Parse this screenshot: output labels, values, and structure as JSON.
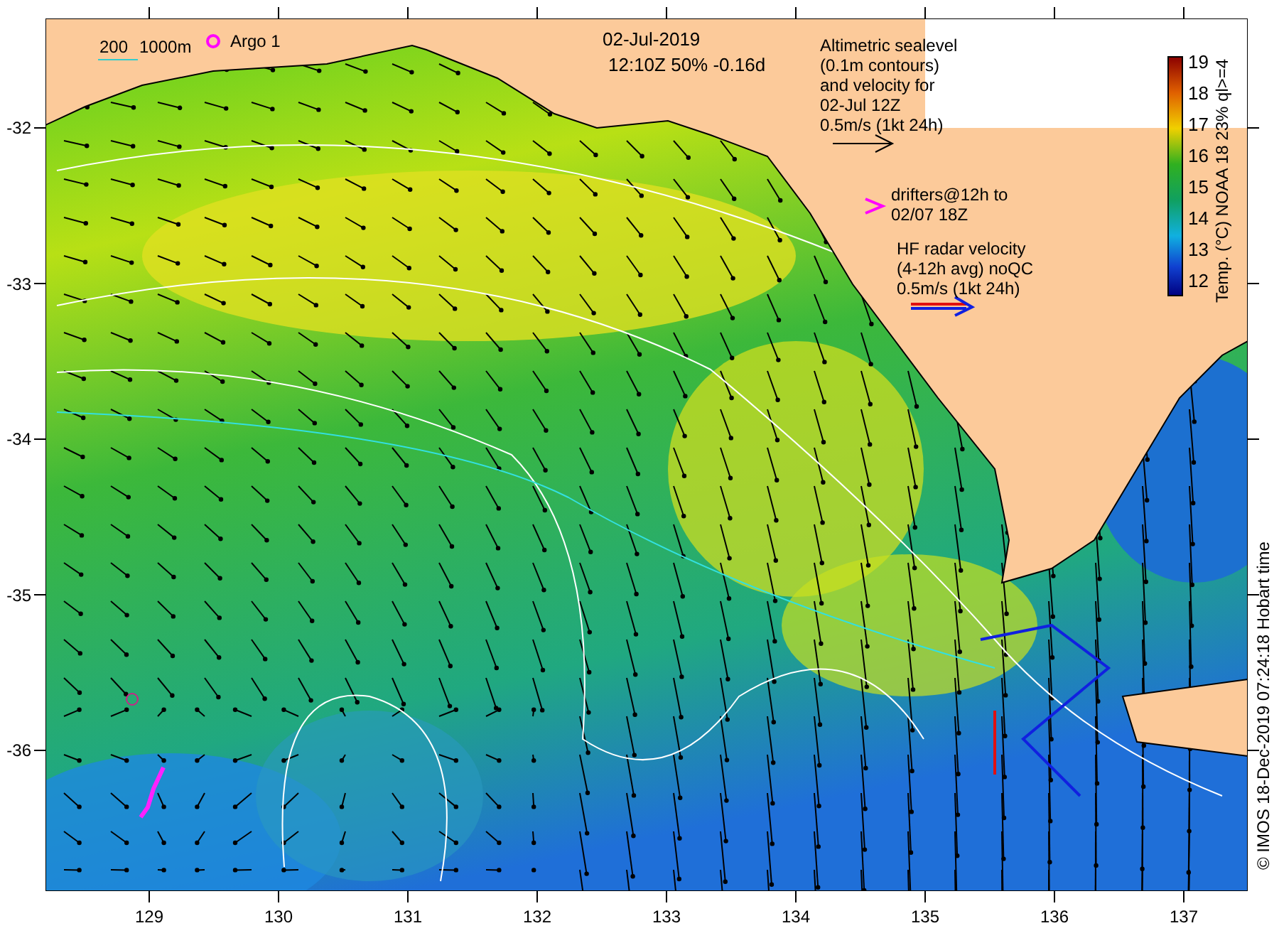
{
  "map": {
    "date": "02-Jul-2019",
    "time_line": "12:10Z  50% -0.16d",
    "depth_legend": {
      "shallow": "200",
      "deep": "1000m"
    },
    "argo_legend": "Argo 1",
    "altimetry_legend": [
      "Altimetric sealevel",
      "(0.1m contours)",
      "and velocity for",
      "02-Jul 12Z",
      "0.5m/s (1kt 24h)"
    ],
    "drifter_legend": [
      "drifters@12h to",
      "02/07 18Z"
    ],
    "radar_legend": [
      "HF radar velocity",
      "(4-12h avg) noQC",
      "0.5m/s (1kt 24h)"
    ],
    "y_axis": {
      "ticks": [
        "-32",
        "-33",
        "-34",
        "-35",
        "-36"
      ]
    },
    "x_axis": {
      "ticks": [
        "129",
        "130",
        "131",
        "132",
        "133",
        "134",
        "135",
        "136",
        "137"
      ]
    },
    "colorbar": {
      "title": "Temp. (°C) NOAA 18 23% ql>=4",
      "ticks": [
        "19",
        "18",
        "17",
        "16",
        "15",
        "14",
        "13",
        "12"
      ]
    },
    "credit": "© IMOS 18-Dec-2019 07:24:18 Hobart time"
  }
}
